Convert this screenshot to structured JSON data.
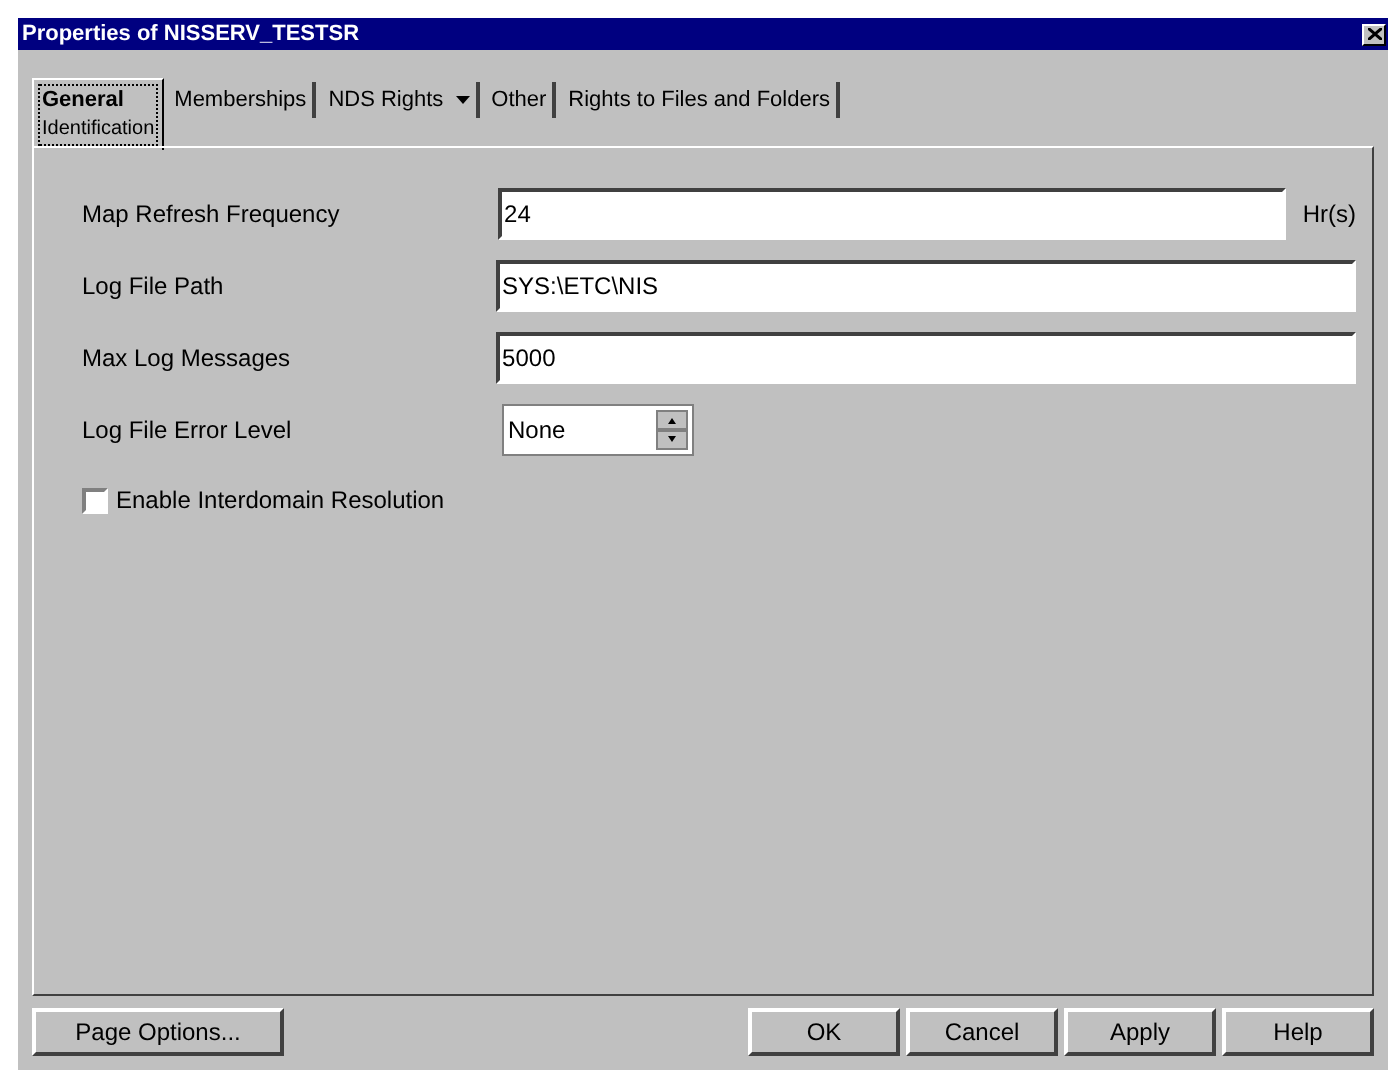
{
  "window": {
    "title": "Properties of NISSERV_TESTSR"
  },
  "tabs": [
    {
      "label": "General",
      "subtitle": "Identification",
      "selected": true
    },
    {
      "label": "Memberships",
      "selected": false
    },
    {
      "label": "NDS Rights",
      "selected": false,
      "dropdown": true
    },
    {
      "label": "Other",
      "selected": false
    },
    {
      "label": "Rights to Files and Folders",
      "selected": false
    }
  ],
  "fields": [
    {
      "kind": "text",
      "label": "Map Refresh Frequency",
      "value": "24",
      "unit": "Hr(s)"
    },
    {
      "kind": "text",
      "label": "Log File Path",
      "value": "SYS:\\ETC\\NIS"
    },
    {
      "kind": "text",
      "label": "Max Log Messages",
      "value": "5000"
    },
    {
      "kind": "spinner",
      "label": "Log File Error Level",
      "value": "None"
    }
  ],
  "checkbox": {
    "label": "Enable Interdomain Resolution",
    "checked": false
  },
  "buttons_left": [
    "Page Options..."
  ],
  "buttons_right": [
    "OK",
    "Cancel",
    "Apply",
    "Help"
  ]
}
